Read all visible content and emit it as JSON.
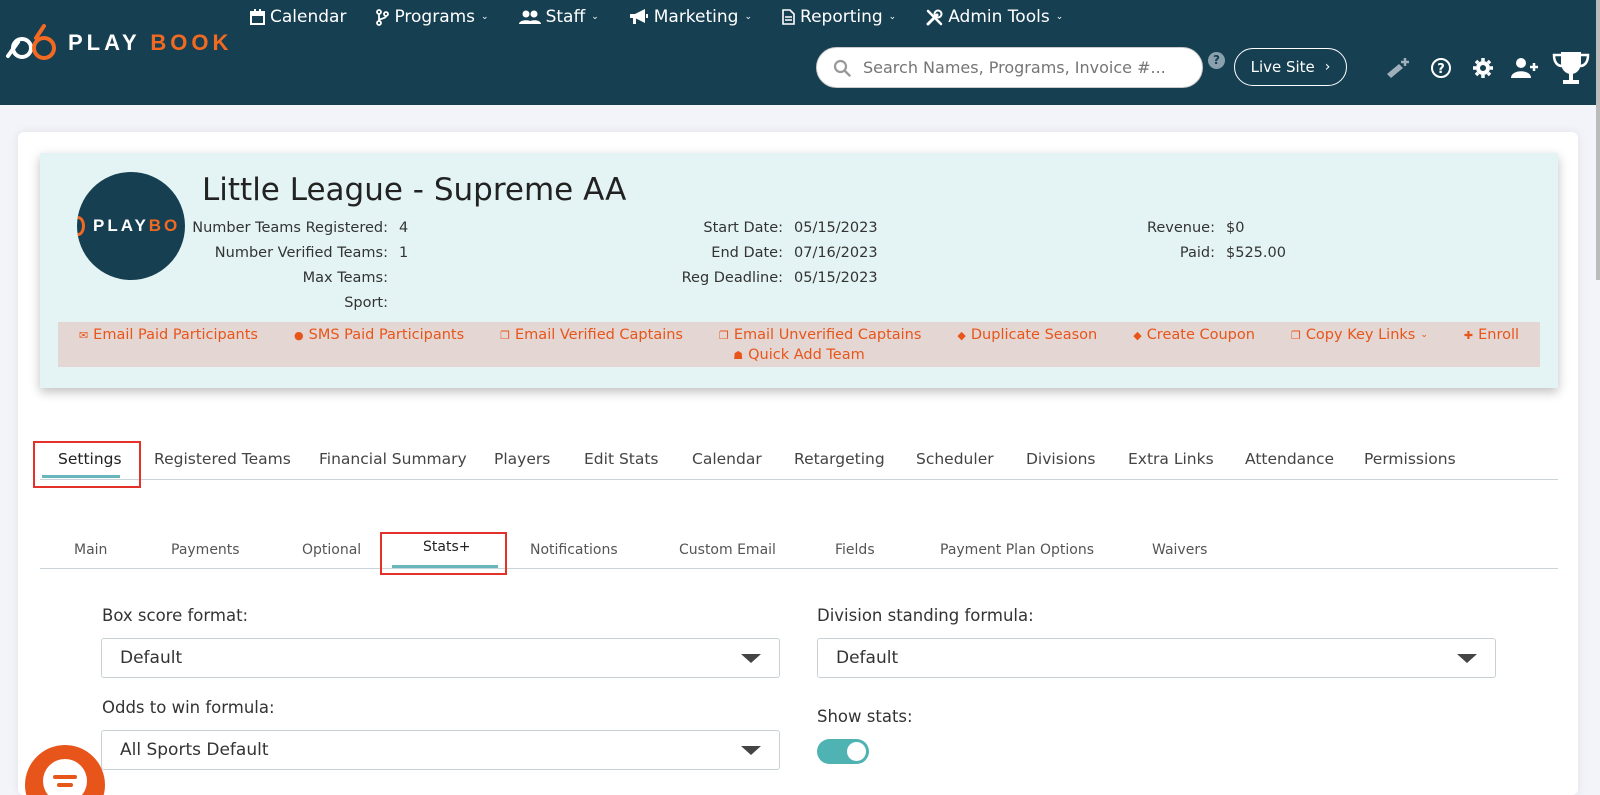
{
  "brand": {
    "logo_text_a": "PLAY",
    "logo_text_b": "BOOK",
    "avatar_text_a": "PLAY",
    "avatar_text_b": "BO"
  },
  "nav": {
    "items": [
      {
        "label": "Calendar",
        "icon": "calendar-icon",
        "caret": false
      },
      {
        "label": "Programs",
        "icon": "branch-icon",
        "caret": true
      },
      {
        "label": "Staff",
        "icon": "users-icon",
        "caret": true
      },
      {
        "label": "Marketing",
        "icon": "megaphone-icon",
        "caret": true
      },
      {
        "label": "Reporting",
        "icon": "document-icon",
        "caret": true
      },
      {
        "label": "Admin Tools",
        "icon": "tools-icon",
        "caret": true
      }
    ],
    "search_placeholder": "Search Names, Programs, Invoice #...",
    "search_help": "?",
    "live_site": "Live Site"
  },
  "season": {
    "title": "Little League - Supreme AA",
    "stats_left": [
      {
        "label": "Number Teams Registered:",
        "value": "4"
      },
      {
        "label": "Number Verified Teams:",
        "value": "1"
      },
      {
        "label": "Max Teams:",
        "value": ""
      },
      {
        "label": "Sport:",
        "value": ""
      }
    ],
    "stats_mid": [
      {
        "label": "Start Date:",
        "value": "05/15/2023"
      },
      {
        "label": "End Date:",
        "value": "07/16/2023"
      },
      {
        "label": "Reg Deadline:",
        "value": "05/15/2023"
      }
    ],
    "stats_right": [
      {
        "label": "Revenue:",
        "value": "$0"
      },
      {
        "label": "Paid:",
        "value": "$525.00"
      }
    ],
    "actions": [
      {
        "label": "Email Paid Participants",
        "icon": "envelope-icon"
      },
      {
        "label": "SMS Paid Participants",
        "icon": "comment-icon"
      },
      {
        "label": "Email Verified Captains",
        "icon": "copy-icon"
      },
      {
        "label": "Email Unverified Captains",
        "icon": "copy-icon"
      },
      {
        "label": "Duplicate Season",
        "icon": "tag-icon"
      },
      {
        "label": "Create Coupon",
        "icon": "tag-icon"
      },
      {
        "label": "Copy Key Links",
        "icon": "copy-icon",
        "caret": true
      },
      {
        "label": "Enroll",
        "icon": "user-plus-icon"
      },
      {
        "label": "Quick Add Team",
        "icon": "users-icon"
      }
    ]
  },
  "tabs": [
    "Settings",
    "Registered Teams",
    "Financial Summary",
    "Players",
    "Edit Stats",
    "Calendar",
    "Retargeting",
    "Scheduler",
    "Divisions",
    "Extra Links",
    "Attendance",
    "Permissions"
  ],
  "active_tab": "Settings",
  "subtabs": [
    "Main",
    "Payments",
    "Optional",
    "Stats+",
    "Notifications",
    "Custom Email",
    "Fields",
    "Payment Plan Options",
    "Waivers"
  ],
  "active_subtab": "Stats+",
  "form": {
    "box_score_label": "Box score format:",
    "box_score_value": "Default",
    "division_label": "Division standing formula:",
    "division_value": "Default",
    "odds_label": "Odds to win formula:",
    "odds_value": "All Sports Default",
    "show_stats_label": "Show stats:",
    "show_stats_on": true
  },
  "colors": {
    "navy": "#163f52",
    "orange": "#e8551b",
    "teal": "#4fb3b3",
    "highlight": "#e4322b"
  }
}
